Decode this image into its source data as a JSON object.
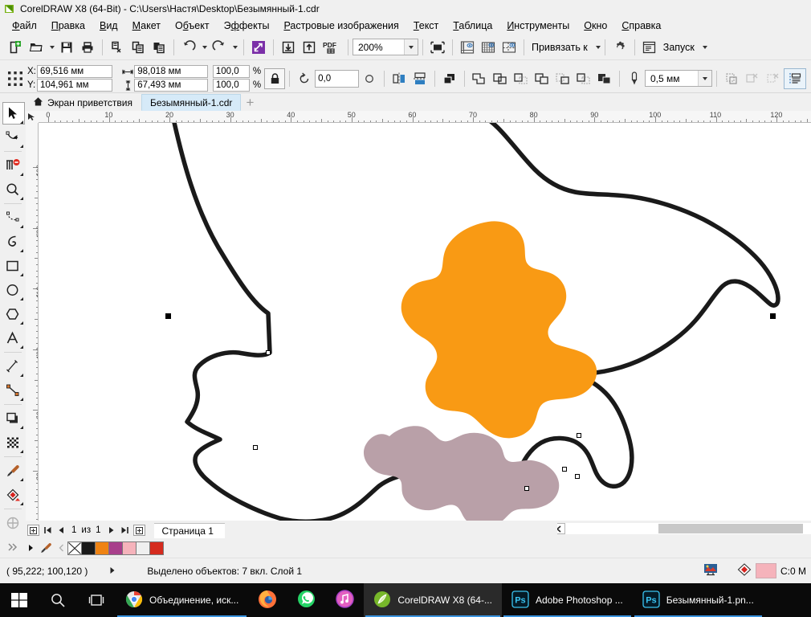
{
  "window": {
    "title": "CorelDRAW X8 (64-Bit) - C:\\Users\\Настя\\Desktop\\Безымянный-1.cdr",
    "app_icon": "coreldraw-logo-icon"
  },
  "menu": {
    "items": [
      {
        "label": "Файл",
        "mnemonic": "Ф"
      },
      {
        "label": "Правка",
        "mnemonic": "П"
      },
      {
        "label": "Вид",
        "mnemonic": "В"
      },
      {
        "label": "Макет",
        "mnemonic": "М"
      },
      {
        "label": "Объект",
        "mnemonic": "ъ"
      },
      {
        "label": "Эффекты",
        "mnemonic": "ф"
      },
      {
        "label": "Растровые изображения",
        "mnemonic": "Р"
      },
      {
        "label": "Текст",
        "mnemonic": "Т"
      },
      {
        "label": "Таблица",
        "mnemonic": "Т"
      },
      {
        "label": "Инструменты",
        "mnemonic": "И"
      },
      {
        "label": "Окно",
        "mnemonic": "О"
      },
      {
        "label": "Справка",
        "mnemonic": "С"
      }
    ]
  },
  "toolbar": {
    "new_label": "Создать",
    "open_label": "Открыть",
    "save_label": "Сохранить",
    "print_label": "Печать",
    "cut_label": "Вырезать",
    "copy_label": "Копировать",
    "paste_label": "Вставить",
    "undo_label": "Отменить",
    "redo_label": "Вернуть",
    "search_label": "Поиск",
    "import_label": "Импорт",
    "export_label": "Экспорт",
    "pdf_label": "PDF",
    "zoom_value": "200%",
    "fullscreen_label": "Полноэкранный просмотр",
    "rulers_label": "Линейки",
    "grid_label": "Сетка",
    "guides_label": "Направляющие",
    "snap_label": "Привязать к",
    "options_label": "Параметры",
    "launch_label": "Запуск"
  },
  "propbar": {
    "x_label": "X:",
    "y_label": "Y:",
    "x_value": "69,516 мм",
    "y_value": "104,961 мм",
    "width_value": "98,018 мм",
    "height_value": "67,493 мм",
    "scale_h": "100,0",
    "scale_v": "100,0",
    "percent": "%",
    "rotation_value": "0,0",
    "outline_width": "0,5 мм",
    "lock_ratio_label": "Заблокировать соотношение",
    "mirror_h_label": "Отразить по горизонтали",
    "mirror_v_label": "Отразить по вертикали",
    "weld_label": "Объединение",
    "trim_label": "Исключение",
    "intersect_label": "Пересечение",
    "simplify_label": "Упрощение",
    "front_minus_back_label": "Передние минус задние",
    "back_minus_front_label": "Задние минус передние",
    "boundary_label": "Граница",
    "wrap_text_label": "Обтекание текстом"
  },
  "tabs": {
    "welcome": "Экран приветствия",
    "document": "Безымянный-1.cdr",
    "add": "+"
  },
  "rulers": {
    "unit": "мм",
    "horizontal_ticks": [
      0,
      10,
      20,
      30,
      40,
      50,
      60,
      70,
      80,
      90,
      100,
      110,
      120
    ],
    "vertical_ticks": [
      130,
      120,
      110,
      100,
      90,
      80
    ]
  },
  "toolbox": {
    "tools": [
      {
        "name": "pick-tool",
        "label": "Выбор",
        "selected": true
      },
      {
        "name": "shape-tool",
        "label": "Форма",
        "selected": false
      },
      {
        "name": "crop-tool",
        "label": "Обрезка",
        "selected": false
      },
      {
        "name": "zoom-tool",
        "label": "Масштаб",
        "selected": false
      },
      {
        "name": "freehand-tool",
        "label": "Свободная форма",
        "selected": false
      },
      {
        "name": "artistic-media-tool",
        "label": "Художественное оформление",
        "selected": false
      },
      {
        "name": "rectangle-tool",
        "label": "Прямоугольник",
        "selected": false
      },
      {
        "name": "ellipse-tool",
        "label": "Эллипс",
        "selected": false
      },
      {
        "name": "polygon-tool",
        "label": "Многоугольник",
        "selected": false
      },
      {
        "name": "text-tool",
        "label": "Текст",
        "selected": false
      },
      {
        "name": "dimension-tool",
        "label": "Размер",
        "selected": false
      },
      {
        "name": "connector-tool",
        "label": "Соединительная линия",
        "selected": false
      },
      {
        "name": "shadow-tool",
        "label": "Тень",
        "selected": false
      },
      {
        "name": "transparency-tool",
        "label": "Прозрачность",
        "selected": false
      },
      {
        "name": "color-eyedropper-tool",
        "label": "Пипетка",
        "selected": false
      },
      {
        "name": "interactive-fill-tool",
        "label": "Интерактивная заливка",
        "selected": false
      },
      {
        "name": "smart-fill-tool",
        "label": "Интеллектуальная заливка",
        "selected": false
      },
      {
        "name": "more-tools",
        "label": "Еще",
        "selected": false
      }
    ]
  },
  "canvas": {
    "shapes": [
      {
        "name": "orange-blob",
        "fill": "#F99A14",
        "label": "Оранжевая фигура"
      },
      {
        "name": "mauve-blob",
        "fill": "#B9A0A8",
        "label": "Сиреневая фигура"
      },
      {
        "name": "black-outline-shape",
        "fill": "none",
        "stroke": "#1a1a1a",
        "label": "Контур"
      }
    ]
  },
  "pagenav": {
    "first_label": "Первая страница",
    "prev_label": "Предыдущая страница",
    "current": "1",
    "of": "из",
    "total": "1",
    "next_label": "Следующая страница",
    "last_label": "Последняя страница",
    "add_page_before_label": "Добавить страницу перед",
    "add_page_after_label": "Добавить страницу после",
    "page_tab": "Страница 1"
  },
  "palette": {
    "no_color_label": "Без цвета",
    "swatches": [
      "#1a1a1a",
      "#ef8313",
      "#a83f8b",
      "#f5b3bb",
      "#efefef",
      "#d52b1e"
    ],
    "scroll_up_label": "Прокрутить вверх",
    "eyedropper_label": "Пипетка",
    "expand_label": "Развернуть"
  },
  "statusbar": {
    "coordinates": "( 95,222; 100,120 )",
    "selection_text": "Выделено объектов: 7 вкл. Слой 1",
    "fill_label": "Заливка",
    "outline_label": "Абрис",
    "fill_color": "#f5b3bb",
    "fill_value": "C:0 M"
  },
  "taskbar": {
    "start_label": "Пуск",
    "search_label": "Поиск",
    "taskview_label": "Представление задач",
    "apps": [
      {
        "name": "chrome",
        "label": "Объединение, иск...",
        "icon": "chrome-icon",
        "active": false,
        "running": true
      },
      {
        "name": "firefox",
        "label": "",
        "icon": "firefox-icon",
        "active": false,
        "running": false
      },
      {
        "name": "whatsapp",
        "label": "",
        "icon": "whatsapp-icon",
        "active": false,
        "running": false
      },
      {
        "name": "itunes",
        "label": "",
        "icon": "itunes-icon",
        "active": false,
        "running": false
      },
      {
        "name": "coreldraw",
        "label": "CorelDRAW X8 (64-...",
        "icon": "coreldraw-icon",
        "active": true,
        "running": true
      },
      {
        "name": "photoshop",
        "label": "Adobe Photoshop ...",
        "icon": "photoshop-icon",
        "active": false,
        "running": true
      },
      {
        "name": "photoshop-doc",
        "label": "Безымянный-1.pn...",
        "icon": "photoshop-icon",
        "active": false,
        "running": true
      }
    ]
  }
}
